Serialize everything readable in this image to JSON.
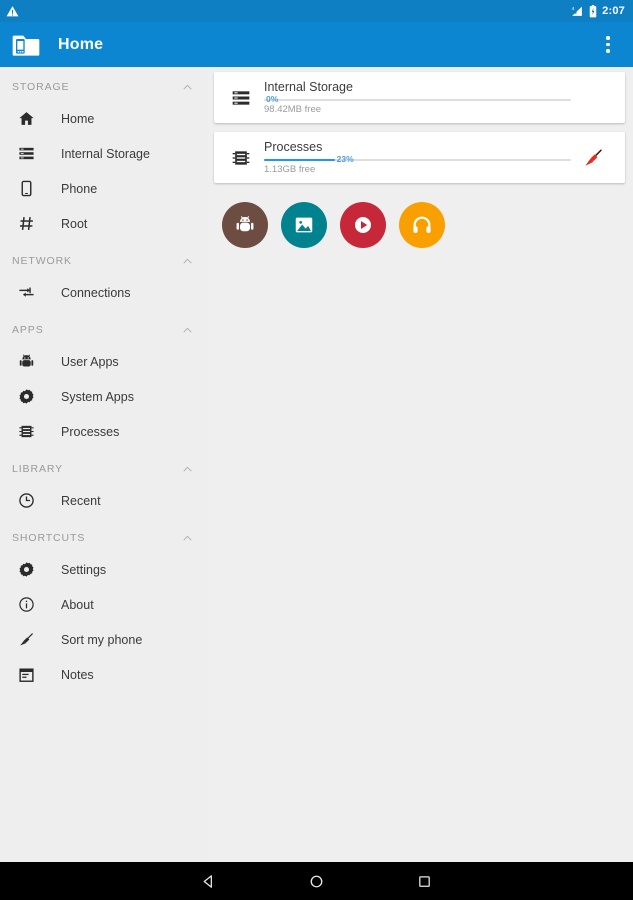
{
  "statusbar": {
    "warning_icon": "warning-triangle-icon",
    "signal_icon": "cellular-signal-icon",
    "battery_icon": "battery-charging-icon",
    "clock": "2:07"
  },
  "appbar": {
    "logo_icon": "folder-phone-logo-icon",
    "title": "Home",
    "overflow_icon": "overflow-menu-icon"
  },
  "sidebar": {
    "sections": [
      {
        "label": "STORAGE",
        "collapse_icon": "chevron-up-icon",
        "items": [
          {
            "label": "Home",
            "icon": "home-icon"
          },
          {
            "label": "Internal Storage",
            "icon": "storage-list-icon"
          },
          {
            "label": "Phone",
            "icon": "phone-icon"
          },
          {
            "label": "Root",
            "icon": "hash-root-icon"
          }
        ]
      },
      {
        "label": "NETWORK",
        "collapse_icon": "chevron-up-icon",
        "items": [
          {
            "label": "Connections",
            "icon": "connections-arrows-icon"
          }
        ]
      },
      {
        "label": "APPS",
        "collapse_icon": "chevron-up-icon",
        "items": [
          {
            "label": "User Apps",
            "icon": "android-robot-icon"
          },
          {
            "label": "System Apps",
            "icon": "gear-icon"
          },
          {
            "label": "Processes",
            "icon": "cpu-chip-icon"
          }
        ]
      },
      {
        "label": "LIBRARY",
        "collapse_icon": "chevron-up-icon",
        "items": [
          {
            "label": "Recent",
            "icon": "clock-icon"
          }
        ]
      },
      {
        "label": "SHORTCUTS",
        "collapse_icon": "chevron-up-icon",
        "items": [
          {
            "label": "Settings",
            "icon": "gear-icon"
          },
          {
            "label": "About",
            "icon": "info-circle-icon"
          },
          {
            "label": "Sort my phone",
            "icon": "broom-icon"
          },
          {
            "label": "Notes",
            "icon": "notes-calendar-icon"
          }
        ]
      }
    ]
  },
  "main": {
    "cards": [
      {
        "icon": "storage-list-icon",
        "title": "Internal Storage",
        "percent_label": "0%",
        "percent_value": 0,
        "subtitle": "98.42MB free",
        "action_icon": ""
      },
      {
        "icon": "cpu-chip-icon",
        "title": "Processes",
        "percent_label": "23%",
        "percent_value": 23,
        "subtitle": "1.13GB free",
        "action_icon": "broom-clean-icon"
      }
    ],
    "shortcut_circles": [
      {
        "name": "apps-shortcut",
        "icon": "android-robot-icon",
        "color": "#6d4c41"
      },
      {
        "name": "images-shortcut",
        "icon": "image-photo-icon",
        "color": "#00838f"
      },
      {
        "name": "videos-shortcut",
        "icon": "play-circle-icon",
        "color": "#c62839"
      },
      {
        "name": "music-shortcut",
        "icon": "headphones-icon",
        "color": "#f9a000"
      }
    ]
  },
  "navbar": {
    "back": "back-triangle-icon",
    "home": "home-circle-icon",
    "recents": "recents-square-icon"
  },
  "colors": {
    "statusbar": "#0f7fc4",
    "appbar": "#0c86d0",
    "background": "#efefef",
    "progress": "#2196f3",
    "percent_text": "#4b9fe0"
  }
}
